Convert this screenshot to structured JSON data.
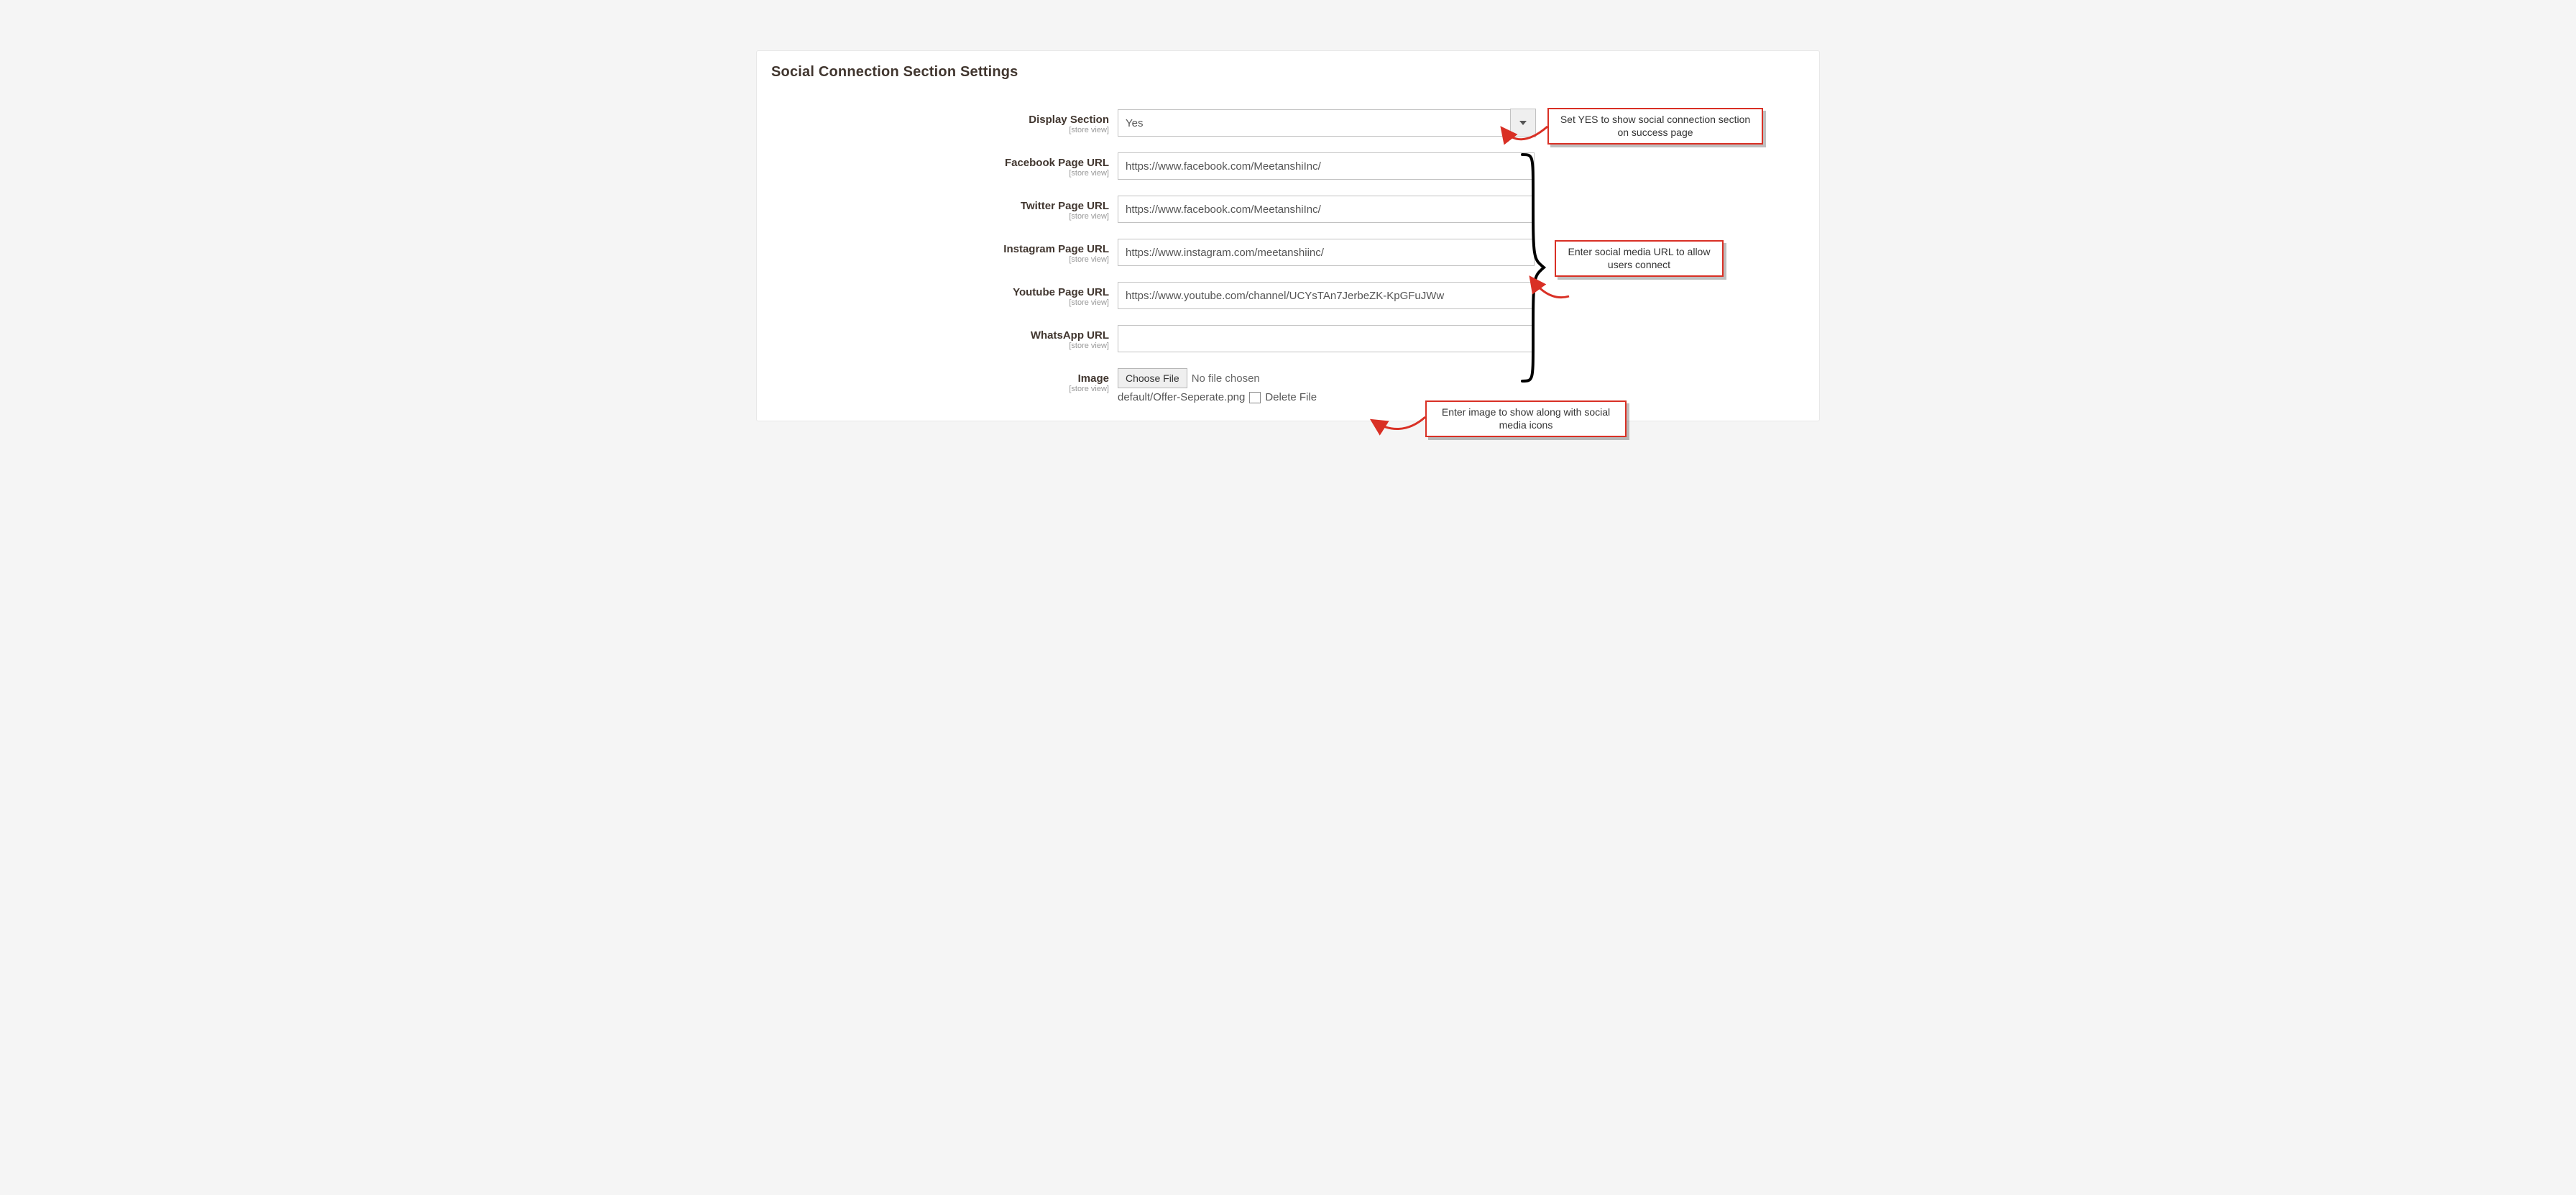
{
  "title": "Social Connection Section Settings",
  "scope": "[store view]",
  "fields": {
    "display": {
      "label": "Display Section",
      "value": "Yes"
    },
    "facebook": {
      "label": "Facebook Page URL",
      "value": "https://www.facebook.com/MeetanshiInc/"
    },
    "twitter": {
      "label": "Twitter Page URL",
      "value": "https://www.facebook.com/MeetanshiInc/"
    },
    "instagram": {
      "label": "Instagram Page URL",
      "value": "https://www.instagram.com/meetanshiinc/"
    },
    "youtube": {
      "label": "Youtube Page URL",
      "value": "https://www.youtube.com/channel/UCYsTAn7JerbeZK-KpGFuJWw"
    },
    "whatsapp": {
      "label": "WhatsApp URL",
      "value": ""
    },
    "image": {
      "label": "Image",
      "button": "Choose File",
      "status": "No file chosen",
      "current": "default/Offer-Seperate.png",
      "delete_label": "Delete File"
    }
  },
  "callouts": {
    "display": "Set YES to show social connection section on success page",
    "urls": "Enter social media URL to allow users connect",
    "image": "Enter image to show along with social media icons"
  }
}
